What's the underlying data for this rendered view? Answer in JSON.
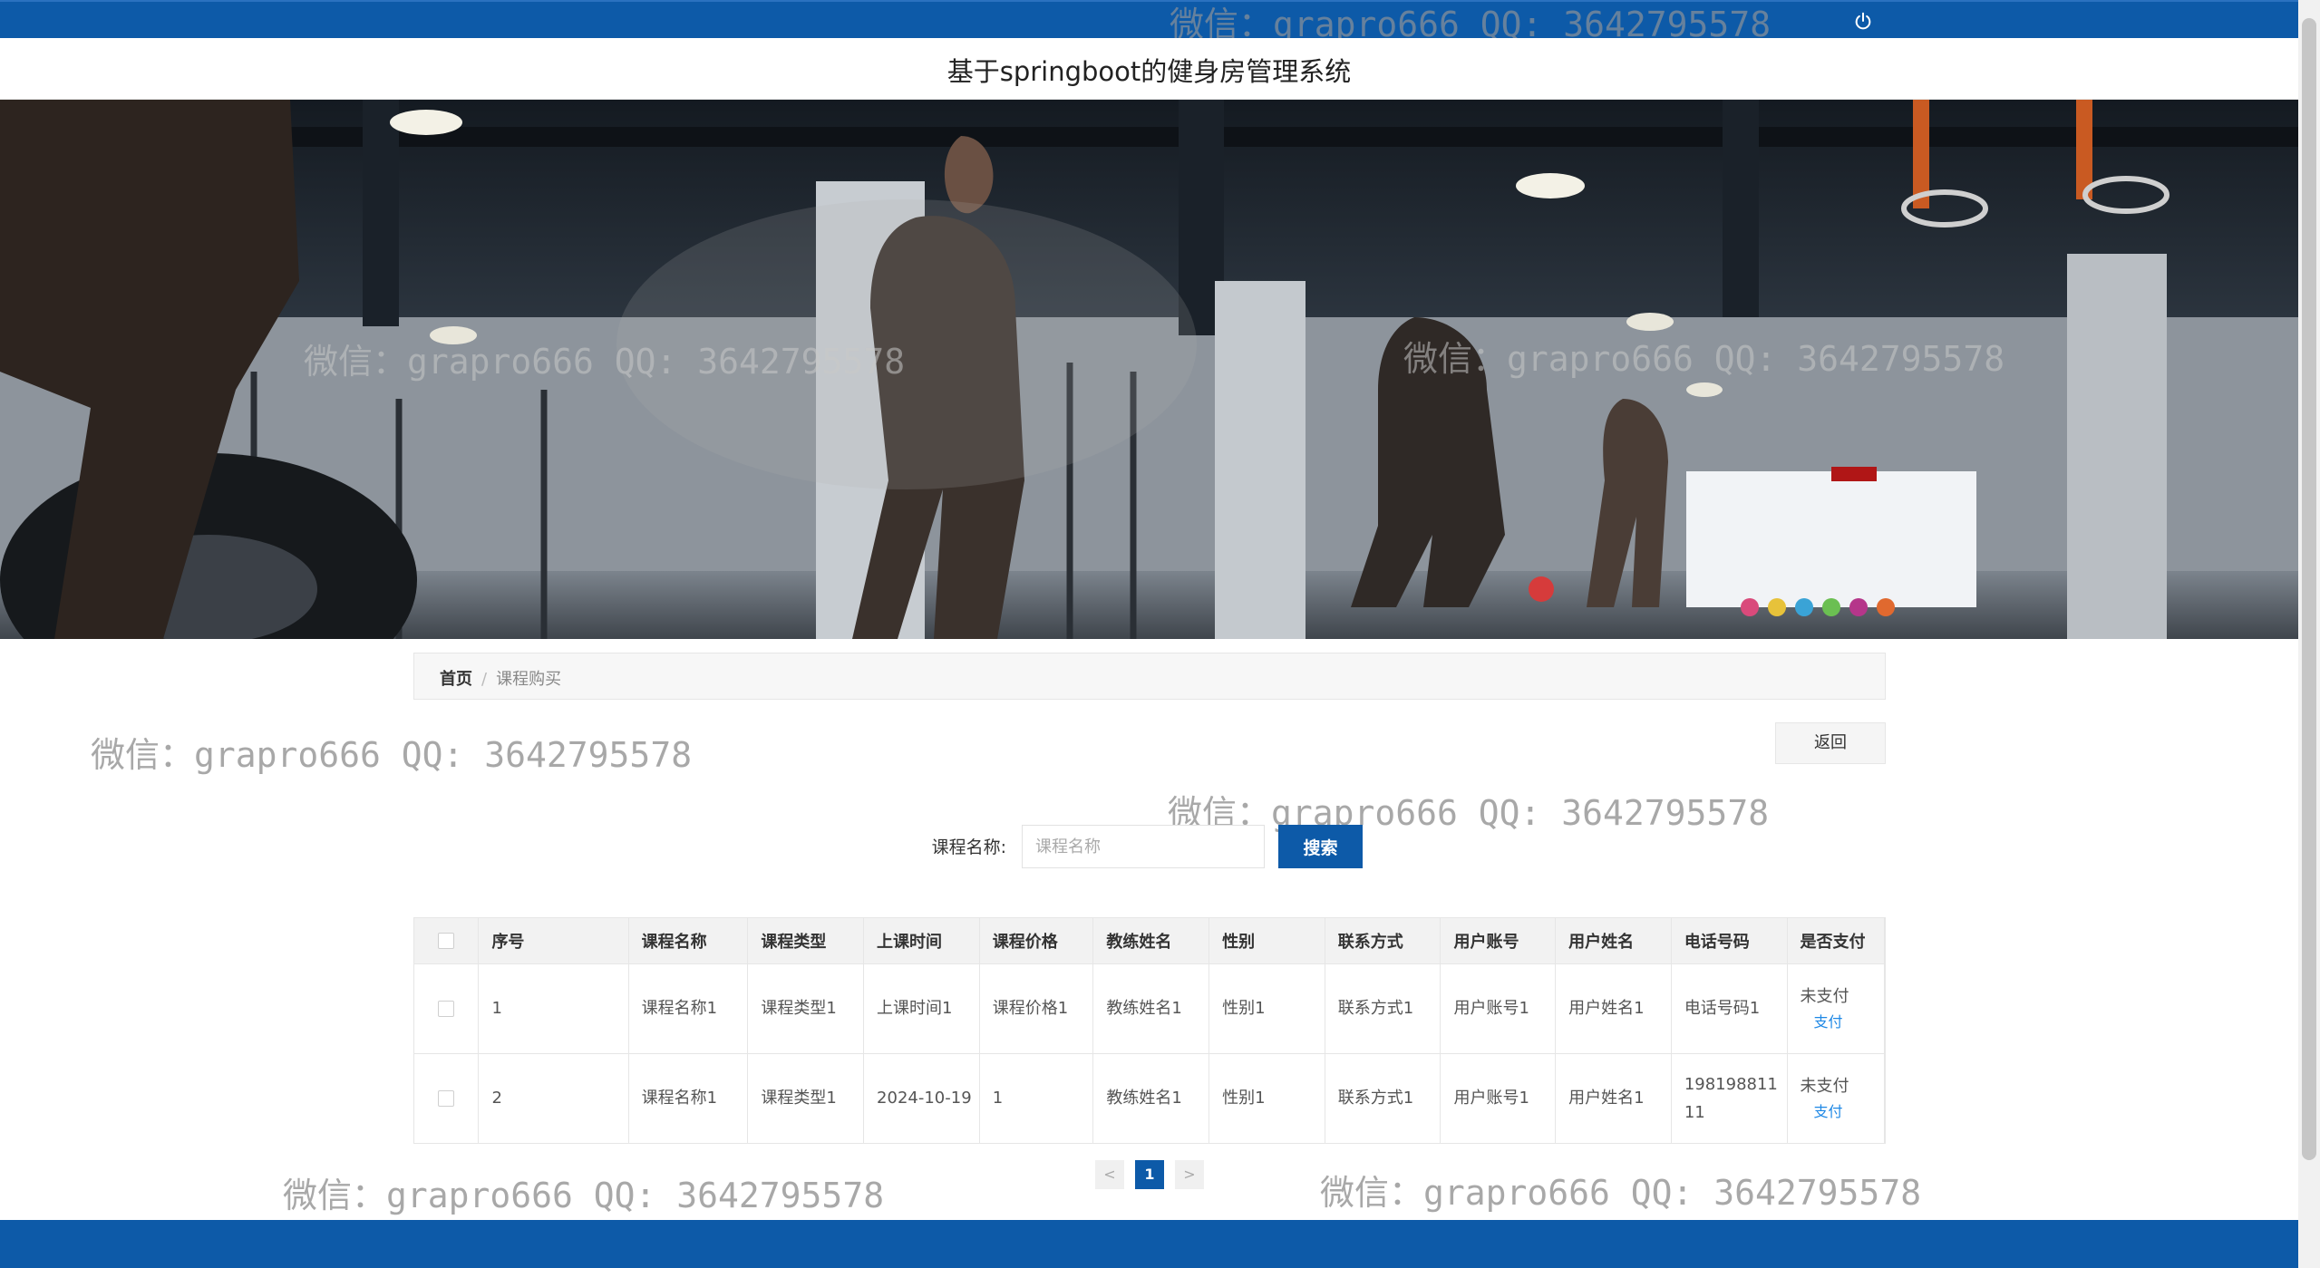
{
  "header": {
    "site_title": "基于springboot的健身房管理系统",
    "power_icon": "power-icon"
  },
  "breadcrumb": {
    "home": "首页",
    "separator": "/",
    "current": "课程购买"
  },
  "actions": {
    "back_label": "返回"
  },
  "search": {
    "label": "课程名称:",
    "placeholder": "课程名称",
    "value": "",
    "button_label": "搜索"
  },
  "table": {
    "headers": [
      "序号",
      "课程名称",
      "课程类型",
      "上课时间",
      "课程价格",
      "教练姓名",
      "性别",
      "联系方式",
      "用户账号",
      "用户姓名",
      "电话号码",
      "是否支付"
    ],
    "rows": [
      {
        "index": "1",
        "course_name": "课程名称1",
        "course_type": "课程类型1",
        "class_time": "上课时间1",
        "price": "课程价格1",
        "coach_name": "教练姓名1",
        "gender": "性别1",
        "contact": "联系方式1",
        "account": "用户账号1",
        "user_name": "用户姓名1",
        "phone": "电话号码1",
        "pay_status": "未支付",
        "pay_action": "支付"
      },
      {
        "index": "2",
        "course_name": "课程名称1",
        "course_type": "课程类型1",
        "class_time": "2024-10-19",
        "price": "1",
        "coach_name": "教练姓名1",
        "gender": "性别1",
        "contact": "联系方式1",
        "account": "用户账号1",
        "user_name": "用户姓名1",
        "phone": "19819881111",
        "pay_status": "未支付",
        "pay_action": "支付"
      }
    ]
  },
  "pagination": {
    "prev": "<",
    "current": "1",
    "next": ">"
  },
  "watermark": {
    "text": "微信：grapro666 QQ: 3642795578"
  },
  "colors": {
    "primary": "#0d5aa8",
    "link": "#1e88e5"
  }
}
